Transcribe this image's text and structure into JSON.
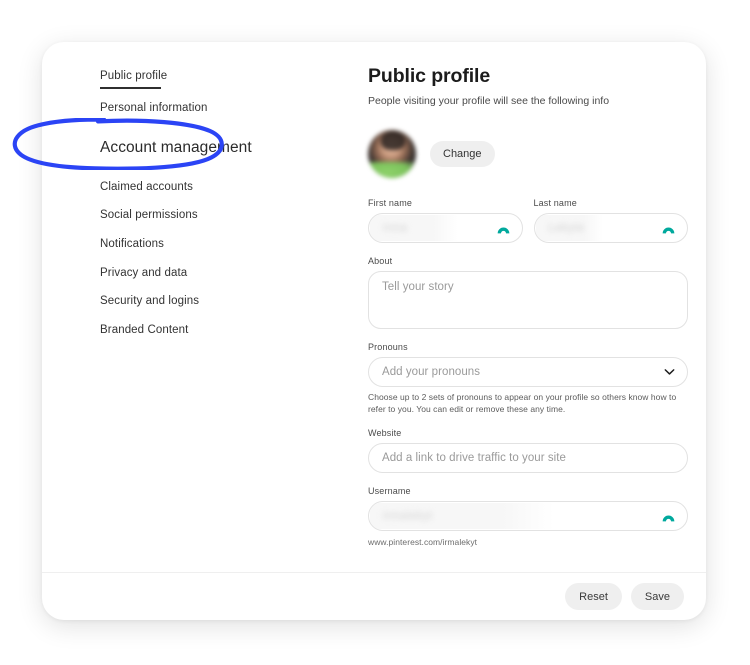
{
  "sidebar": {
    "items": [
      {
        "label": "Public profile",
        "state": "active-underline"
      },
      {
        "label": "Personal information",
        "state": "normal"
      },
      {
        "label": "Account management",
        "state": "highlighted"
      },
      {
        "label": "Claimed accounts",
        "state": "normal"
      },
      {
        "label": "Social permissions",
        "state": "normal"
      },
      {
        "label": "Notifications",
        "state": "normal"
      },
      {
        "label": "Privacy and data",
        "state": "normal"
      },
      {
        "label": "Security and logins",
        "state": "normal"
      },
      {
        "label": "Branded Content",
        "state": "normal"
      }
    ]
  },
  "annotation": {
    "target": "Account management",
    "color": "#2b44f5",
    "shape": "hand-drawn-oval"
  },
  "content": {
    "title": "Public profile",
    "subtitle": "People visiting your profile will see the following info",
    "avatar": {
      "alt": "profile photo",
      "change_label": "Change"
    },
    "fields": {
      "first_name": {
        "label": "First name",
        "value": "Irma",
        "masked": true,
        "icon": "dashlane-arch-icon"
      },
      "last_name": {
        "label": "Last name",
        "value": "Lekyte",
        "masked": true,
        "icon": "dashlane-arch-icon"
      },
      "about": {
        "label": "About",
        "value": "",
        "placeholder": "Tell your story"
      },
      "pronouns": {
        "label": "Pronouns",
        "value": "",
        "placeholder": "Add your pronouns",
        "icon": "chevron-down-icon",
        "helper": "Choose up to 2 sets of pronouns to appear on your profile so others know how to refer to you. You can edit or remove these any time."
      },
      "website": {
        "label": "Website",
        "value": "",
        "placeholder": "Add a link to drive traffic to your site"
      },
      "username": {
        "label": "Username",
        "value": "irmalekyt",
        "masked": true,
        "icon": "dashlane-arch-icon",
        "url_note": "www.pinterest.com/irmalekyt"
      }
    }
  },
  "footer": {
    "reset_label": "Reset",
    "save_label": "Save"
  },
  "colors": {
    "annotation_blue": "#2b44f5",
    "autofill_teal": "#00a99d",
    "button_gray": "#efefef",
    "text_primary": "#1c1c1c",
    "border": "#e2e2e2"
  }
}
